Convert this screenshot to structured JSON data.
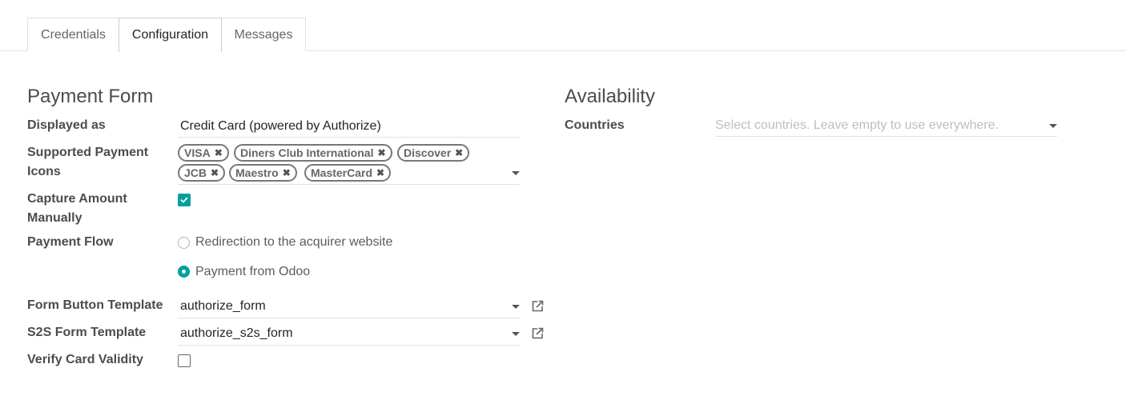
{
  "tabs": [
    {
      "label": "Credentials"
    },
    {
      "label": "Configuration",
      "active": true
    },
    {
      "label": "Messages"
    }
  ],
  "payment_form": {
    "title": "Payment Form",
    "displayed_as": {
      "label": "Displayed as",
      "value": "Credit Card (powered by Authorize)"
    },
    "supported_icons": {
      "label_line1": "Supported Payment",
      "label_line2": "Icons",
      "tags": [
        "VISA",
        "Diners Club International",
        "Discover",
        "JCB",
        "Maestro",
        "MasterCard"
      ],
      "remove_glyph": "✖"
    },
    "capture_amount": {
      "label_line1": "Capture Amount",
      "label_line2": "Manually",
      "checked": true
    },
    "payment_flow": {
      "label": "Payment Flow",
      "options": [
        {
          "label": "Redirection to the acquirer website",
          "selected": false
        },
        {
          "label": "Payment from Odoo",
          "selected": true
        }
      ]
    },
    "form_button_template": {
      "label": "Form Button Template",
      "value": "authorize_form"
    },
    "s2s_form_template": {
      "label": "S2S Form Template",
      "value": "authorize_s2s_form"
    },
    "verify_card_validity": {
      "label": "Verify Card Validity",
      "checked": false
    }
  },
  "availability": {
    "title": "Availability",
    "countries": {
      "label": "Countries",
      "placeholder": "Select countries. Leave empty to use everywhere."
    }
  },
  "colors": {
    "accent": "#00A09D",
    "label": "#4c4c4c",
    "border": "#dee2e6"
  },
  "icons": {
    "external_link": "external-link-icon",
    "dropdown": "caret-down-icon",
    "check": "check-icon"
  }
}
